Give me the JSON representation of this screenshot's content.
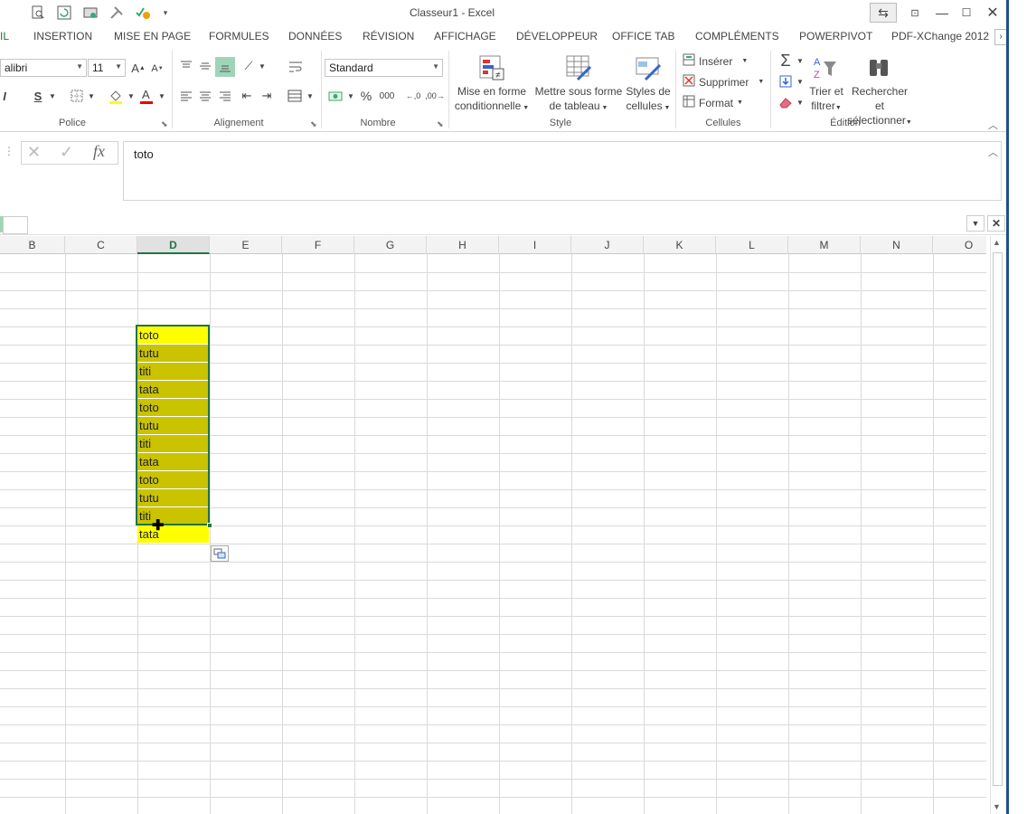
{
  "window": {
    "title": "Classeur1 - Excel"
  },
  "tabs": [
    "IL",
    "INSERTION",
    "MISE EN PAGE",
    "FORMULES",
    "DONNÉES",
    "RÉVISION",
    "AFFICHAGE",
    "DÉVELOPPEUR",
    "OFFICE TAB",
    "COMPLÉMENTS",
    "POWERPIVOT",
    "PDF-XChange 2012"
  ],
  "ribbon": {
    "font_name": "alibri",
    "font_size": "11",
    "number_format": "Standard",
    "groups": {
      "police": "Police",
      "alignement": "Alignement",
      "nombre": "Nombre",
      "style": "Style",
      "cellules": "Cellules",
      "edition": "Édition"
    },
    "style_buttons": {
      "cond_line1": "Mise en forme",
      "cond_line2": "conditionnelle",
      "table_line1": "Mettre sous forme",
      "table_line2": "de tableau",
      "styles_line1": "Styles de",
      "styles_line2": "cellules"
    },
    "cells_cmds": {
      "insert": "Insérer",
      "delete": "Supprimer",
      "format": "Format"
    },
    "edit_cmds": {
      "sort_line1": "Trier et",
      "sort_line2": "filtrer",
      "find_line1": "Rechercher et",
      "find_line2": "sélectionner"
    },
    "bold_label": "I",
    "strike_label": "S",
    "percent": "%",
    "thousands": "000"
  },
  "formula_bar": {
    "value": "toto",
    "fx": "fx"
  },
  "columns": [
    "B",
    "C",
    "D",
    "E",
    "F",
    "G",
    "H",
    "I",
    "J",
    "K",
    "L",
    "M",
    "N",
    "O"
  ],
  "selected_column": "D",
  "cells_D": [
    "toto",
    "tutu",
    "titi",
    "tata",
    "toto",
    "tutu",
    "titi",
    "tata",
    "toto",
    "tutu",
    "titi",
    "tata"
  ],
  "colors": {
    "accent": "#217346",
    "selection_fill": "#c9c300",
    "highlight": "#ffff00"
  }
}
